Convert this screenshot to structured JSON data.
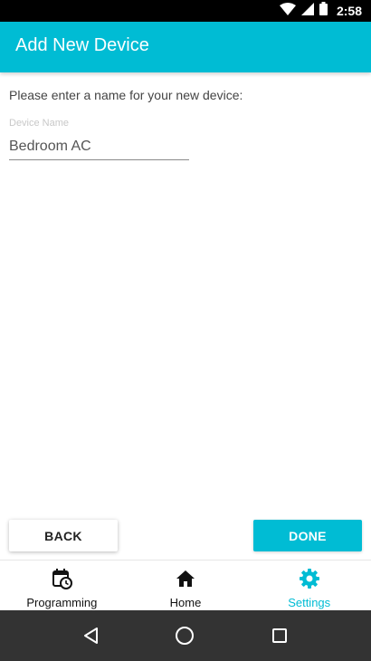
{
  "status_bar": {
    "time": "2:58"
  },
  "app_bar": {
    "title": "Add New Device"
  },
  "form": {
    "prompt": "Please enter a name for your new device:",
    "device_name_label": "Device Name",
    "device_name_value": "Bedroom AC"
  },
  "actions": {
    "back_label": "BACK",
    "done_label": "DONE"
  },
  "bottom_nav": {
    "items": [
      {
        "label": "Programming",
        "icon": "calendar-clock-icon",
        "active": false
      },
      {
        "label": "Home",
        "icon": "home-icon",
        "active": false
      },
      {
        "label": "Settings",
        "icon": "gear-icon",
        "active": true
      }
    ]
  },
  "system_nav": {
    "buttons": [
      "back-triangle-icon",
      "home-circle-icon",
      "recents-square-icon"
    ]
  },
  "colors": {
    "accent": "#00bcd4",
    "status_bar": "#000000",
    "system_nav": "#333333"
  }
}
